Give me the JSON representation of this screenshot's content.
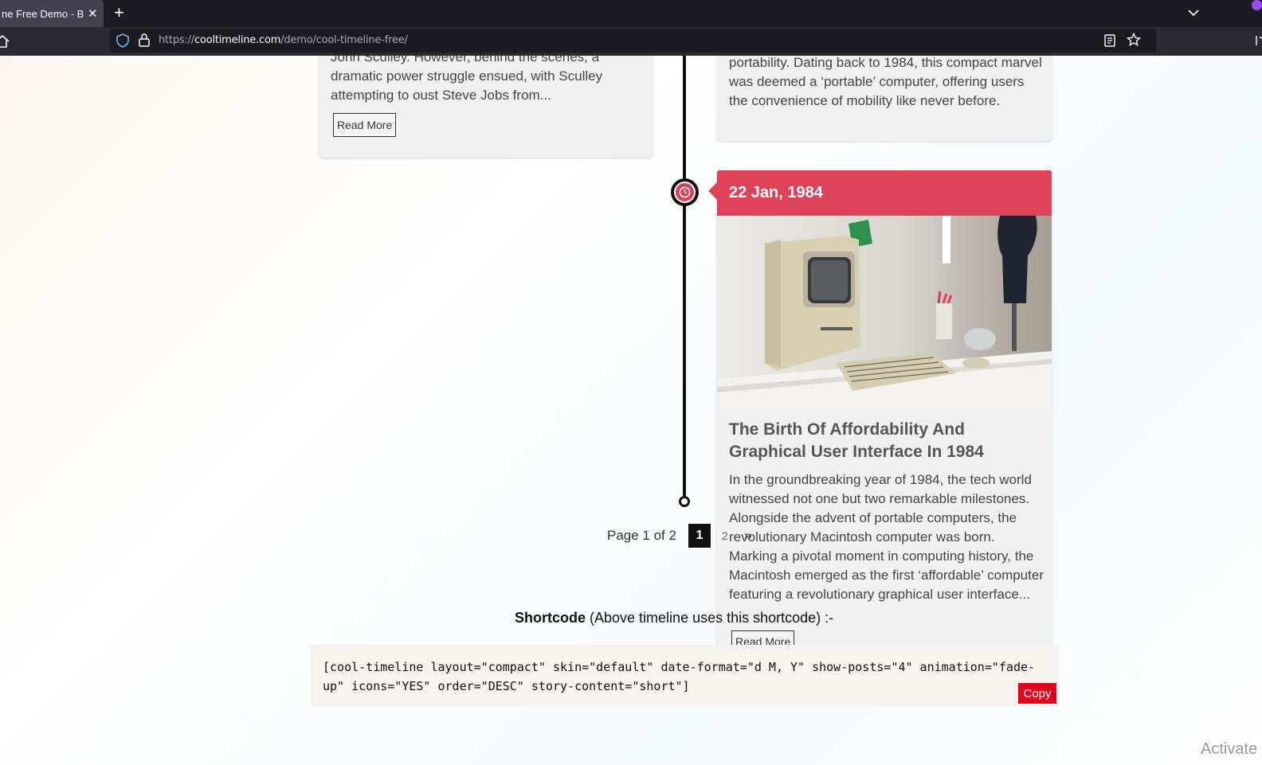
{
  "browser": {
    "tab_title": "ne Free Demo - Best",
    "tab_close": "✕",
    "new_tab": "+",
    "url_scheme": "https://",
    "url_host": "cooltimeline.com",
    "url_path": "/demo/cool-timeline-free/"
  },
  "timeline": {
    "left_card": {
      "text": "John Sculley. However, behind the scenes, a dramatic power struggle ensued, with Sculley attempting to oust Steve Jobs from...",
      "read_more": "Read More"
    },
    "right_top_card": {
      "text": "portability. Dating back to 1984, this compact marvel was deemed a ‘portable’ computer, offering users the convenience of mobility like never before."
    },
    "main_card": {
      "date": "22 Jan, 1984",
      "title": "The Birth Of Affordability And Graphical User Interface In 1984",
      "text": "In the groundbreaking year of 1984, the tech world witnessed not one but two remarkable milestones. Alongside the advent of portable computers, the revolutionary Macintosh computer was born. Marking a pivotal moment in computing history, the Macintosh emerged as the first ‘affordable’ computer featuring a revolutionary graphical user interface...",
      "read_more": "Read More",
      "accent_color": "#dd4259"
    }
  },
  "pagination": {
    "info": "Page 1 of 2",
    "current": "1",
    "next_page": "2",
    "next_icon": "»"
  },
  "shortcode": {
    "heading_bold": "Shortcode",
    "heading_rest": " (Above timeline uses this shortcode) :-",
    "code": "[cool-timeline layout=\"compact\" skin=\"default\" date-format=\"d M, Y\" show-posts=\"4\" animation=\"fade-up\" icons=\"YES\" order=\"DESC\" story-content=\"short\"]",
    "copy_label": "Copy"
  },
  "watermark": "Activate"
}
